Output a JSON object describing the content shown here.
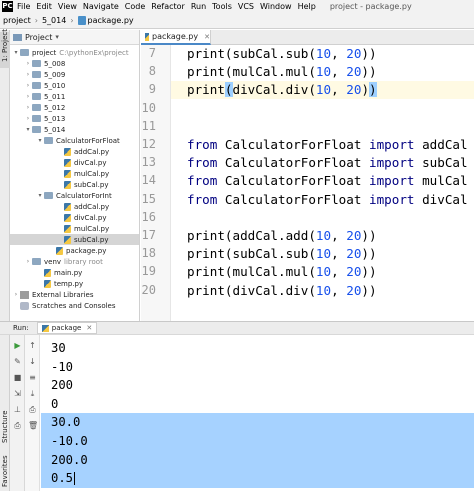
{
  "menubar": {
    "app_icon": "PC",
    "items": [
      "File",
      "Edit",
      "View",
      "Navigate",
      "Code",
      "Refactor",
      "Run",
      "Tools",
      "VCS",
      "Window",
      "Help"
    ],
    "window_title": "project - package.py"
  },
  "breadcrumb": {
    "items": [
      "project",
      "5_014",
      "package.py"
    ]
  },
  "left_strip": {
    "tab_label": "1: Project"
  },
  "project_panel": {
    "title": "Project",
    "tree": [
      {
        "label": "project",
        "extra": "C:\\pythonEx\\project",
        "type": "folder",
        "expanded": true
      },
      {
        "label": "5_008",
        "type": "folder",
        "expanded": false
      },
      {
        "label": "5_009",
        "type": "folder",
        "expanded": false
      },
      {
        "label": "5_010",
        "type": "folder",
        "expanded": false
      },
      {
        "label": "5_011",
        "type": "folder",
        "expanded": false
      },
      {
        "label": "5_012",
        "type": "folder",
        "expanded": false
      },
      {
        "label": "5_013",
        "type": "folder",
        "expanded": false
      },
      {
        "label": "5_014",
        "type": "folder",
        "expanded": true
      },
      {
        "label": "CalculatorForFloat",
        "type": "folder",
        "expanded": true
      },
      {
        "label": "addCal.py",
        "type": "py"
      },
      {
        "label": "divCal.py",
        "type": "py"
      },
      {
        "label": "mulCal.py",
        "type": "py"
      },
      {
        "label": "subCal.py",
        "type": "py"
      },
      {
        "label": "CalculatorForInt",
        "type": "folder",
        "expanded": true
      },
      {
        "label": "addCal.py",
        "type": "py"
      },
      {
        "label": "divCal.py",
        "type": "py"
      },
      {
        "label": "mulCal.py",
        "type": "py"
      },
      {
        "label": "subCal.py",
        "type": "py",
        "selected": true
      },
      {
        "label": "package.py",
        "type": "py"
      },
      {
        "label": "venv",
        "extra": "library root",
        "type": "folder",
        "expanded": false
      },
      {
        "label": "main.py",
        "type": "py"
      },
      {
        "label": "temp.py",
        "type": "py"
      },
      {
        "label": "External Libraries",
        "type": "lib",
        "expanded": false
      },
      {
        "label": "Scratches and Consoles",
        "type": "scratch"
      }
    ]
  },
  "editor": {
    "tab_label": "package.py",
    "lines": [
      {
        "no": "7",
        "parts": [
          [
            "t",
            "print(subCal.sub("
          ],
          [
            "n",
            "10"
          ],
          [
            "t",
            ", "
          ],
          [
            "n",
            "20"
          ],
          [
            "t",
            "))"
          ]
        ]
      },
      {
        "no": "8",
        "parts": [
          [
            "t",
            "print(mulCal.mul("
          ],
          [
            "n",
            "10"
          ],
          [
            "t",
            ", "
          ],
          [
            "n",
            "20"
          ],
          [
            "t",
            "))"
          ]
        ]
      },
      {
        "no": "9",
        "current": true,
        "parts": [
          [
            "t",
            "print"
          ],
          [
            "b",
            "("
          ],
          [
            "t",
            "divCal.div("
          ],
          [
            "n",
            "10"
          ],
          [
            "t",
            ", "
          ],
          [
            "n",
            "20"
          ],
          [
            "t",
            ")"
          ],
          [
            "b",
            ")"
          ]
        ]
      },
      {
        "no": "10",
        "parts": []
      },
      {
        "no": "11",
        "parts": []
      },
      {
        "no": "12",
        "parts": [
          [
            "k",
            "from"
          ],
          [
            "t",
            " CalculatorForFloat "
          ],
          [
            "k",
            "import"
          ],
          [
            "t",
            " addCal"
          ]
        ]
      },
      {
        "no": "13",
        "parts": [
          [
            "k",
            "from"
          ],
          [
            "t",
            " CalculatorForFloat "
          ],
          [
            "k",
            "import"
          ],
          [
            "t",
            " subCal"
          ]
        ]
      },
      {
        "no": "14",
        "parts": [
          [
            "k",
            "from"
          ],
          [
            "t",
            " CalculatorForFloat "
          ],
          [
            "k",
            "import"
          ],
          [
            "t",
            " mulCal"
          ]
        ]
      },
      {
        "no": "15",
        "parts": [
          [
            "k",
            "from"
          ],
          [
            "t",
            " CalculatorForFloat "
          ],
          [
            "k",
            "import"
          ],
          [
            "t",
            " divCal"
          ]
        ]
      },
      {
        "no": "16",
        "parts": []
      },
      {
        "no": "17",
        "parts": [
          [
            "t",
            "print(addCal.add("
          ],
          [
            "n",
            "10"
          ],
          [
            "t",
            ", "
          ],
          [
            "n",
            "20"
          ],
          [
            "t",
            "))"
          ]
        ]
      },
      {
        "no": "18",
        "parts": [
          [
            "t",
            "print(subCal.sub("
          ],
          [
            "n",
            "10"
          ],
          [
            "t",
            ", "
          ],
          [
            "n",
            "20"
          ],
          [
            "t",
            "))"
          ]
        ]
      },
      {
        "no": "19",
        "parts": [
          [
            "t",
            "print(mulCal.mul("
          ],
          [
            "n",
            "10"
          ],
          [
            "t",
            ", "
          ],
          [
            "n",
            "20"
          ],
          [
            "t",
            "))"
          ]
        ]
      },
      {
        "no": "20",
        "parts": [
          [
            "t",
            "print(divCal.div("
          ],
          [
            "n",
            "10"
          ],
          [
            "t",
            ", "
          ],
          [
            "n",
            "20"
          ],
          [
            "t",
            "))"
          ]
        ]
      }
    ]
  },
  "run_panel": {
    "label": "Run:",
    "tab_label": "package",
    "side_tabs": [
      "Structure",
      "Favorites"
    ],
    "output": [
      {
        "text": "30",
        "selected": false
      },
      {
        "text": "-10",
        "selected": false
      },
      {
        "text": "200",
        "selected": false
      },
      {
        "text": "0",
        "selected": false
      },
      {
        "text": "30.0",
        "selected": true
      },
      {
        "text": "-10.0",
        "selected": true
      },
      {
        "text": "200.0",
        "selected": true
      },
      {
        "text": "0.5",
        "selected": true
      }
    ]
  }
}
